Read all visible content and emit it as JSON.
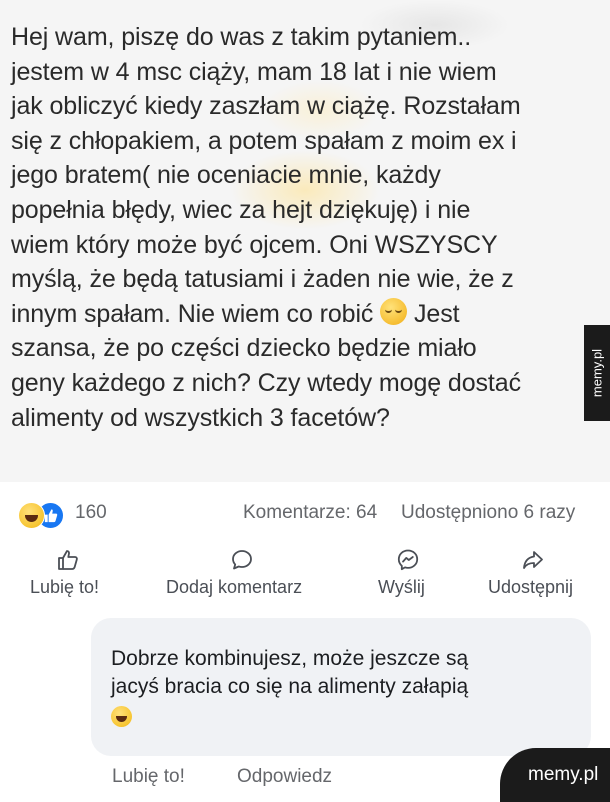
{
  "post": {
    "text_before_emoji": "Hej wam, piszę do was z takim pytaniem..\njestem w 4 msc ciąży, mam 18 lat i nie wiem\njak obliczyć kiedy zaszłam w ciążę. Rozstałam\nsię z chłopakiem, a potem spałam z moim ex i\njego bratem( nie oceniacie mnie, każdy\npopełnia błędy, wiec za hejt dziękuję)  i nie\nwiem który może być ojcem. Oni WSZYSCY\nmyślą, że będą tatusiami i żaden nie wie, że  z\ninnym spałam. Nie wiem co robić ",
    "text_after_emoji": " Jest\nszansa, że po części dziecko będzie miało\ngeny każdego z nich? Czy wtedy mogę dostać\nalimenty od wszystkich 3 facetów?",
    "emoji": "sleepy-face-emoji"
  },
  "side_watermark": "memy.pl",
  "stats": {
    "reaction_icons": [
      "haha-reaction-icon",
      "like-reaction-icon"
    ],
    "reaction_count": "160",
    "comments": "Komentarze: 64",
    "shares": "Udostępniono 6 razy"
  },
  "actions": {
    "like": {
      "label": "Lubię to!",
      "icon": "thumbs-up-icon"
    },
    "comment": {
      "label": "Dodaj komentarz",
      "icon": "speech-bubble-icon"
    },
    "send": {
      "label": "Wyślij",
      "icon": "messenger-icon"
    },
    "share": {
      "label": "Udostępnij",
      "icon": "share-arrow-icon"
    }
  },
  "comment": {
    "text": "Dobrze kombinujesz,  może jeszcze są\njacyś bracia co się na alimenty załapią",
    "emoji": "grinning-face-emoji",
    "like_label": "Lubię to!",
    "reply_label": "Odpowiedz"
  },
  "badge": "memy.pl",
  "colors": {
    "facebook_blue": "#1877f2",
    "meta_text": "#65676b",
    "bubble_bg": "#f0f2f5",
    "badge_bg": "#1b1b1b"
  }
}
